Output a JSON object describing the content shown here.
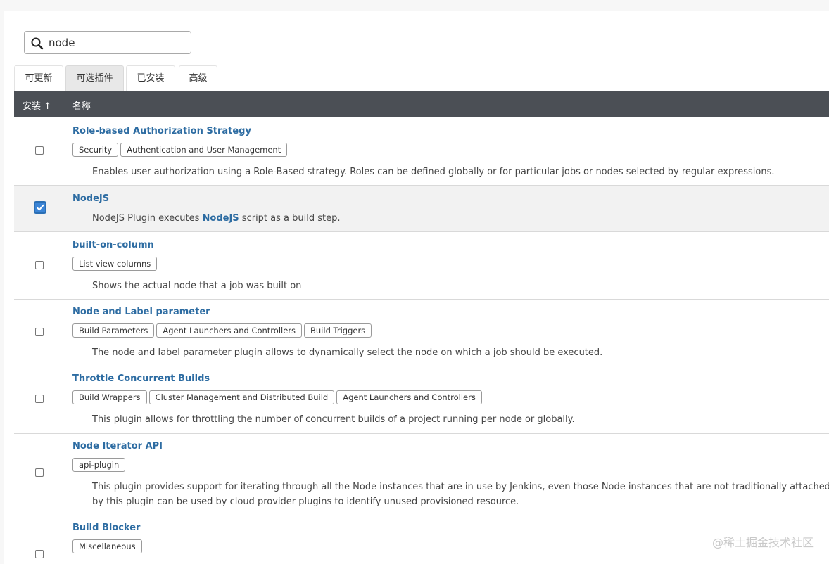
{
  "search": {
    "value": "node"
  },
  "tabs": [
    {
      "label": "可更新"
    },
    {
      "label": "可选插件"
    },
    {
      "label": "已安装"
    },
    {
      "label": "高级"
    }
  ],
  "active_tab": "可选插件",
  "table": {
    "header_install": "安装 ↑",
    "header_name": "名称"
  },
  "plugins": [
    {
      "name": "Role-based Authorization Strategy",
      "checked": false,
      "tags": [
        "Security",
        "Authentication and User Management"
      ],
      "description": "Enables user authorization using a Role-Based strategy. Roles can be defined globally or for particular jobs or nodes selected by regular expressions."
    },
    {
      "name": "NodeJS",
      "checked": true,
      "tags": [],
      "description_prefix": "NodeJS Plugin executes ",
      "description_link": "NodeJS",
      "description_suffix": " script as a build step."
    },
    {
      "name": "built-on-column",
      "checked": false,
      "tags": [
        "List view columns"
      ],
      "description": "Shows the actual node that a job was built on"
    },
    {
      "name": "Node and Label parameter",
      "checked": false,
      "tags": [
        "Build Parameters",
        "Agent Launchers and Controllers",
        "Build Triggers"
      ],
      "description": "The node and label parameter plugin allows to dynamically select the node on which a job should be executed."
    },
    {
      "name": "Throttle Concurrent Builds",
      "checked": false,
      "tags": [
        "Build Wrappers",
        "Cluster Management and Distributed Build",
        "Agent Launchers and Controllers"
      ],
      "description": "This plugin allows for throttling the number of concurrent builds of a project running per node or globally."
    },
    {
      "name": "Node Iterator API",
      "checked": false,
      "tags": [
        "api-plugin"
      ],
      "description": "This plugin provides support for iterating through all the Node instances that are in use by Jenkins, even those Node instances that are not traditionally attached to",
      "description_line2": "by this plugin can be used by cloud provider plugins to identify unused provisioned resource."
    },
    {
      "name": "Build Blocker",
      "checked": false,
      "tags": [
        "Miscellaneous"
      ]
    }
  ],
  "watermark": "@稀土掘金技术社区",
  "colors": {
    "header_bg": "#4b4f55",
    "link": "#2d6ca2",
    "checkbox_checked": "#3b84d6",
    "active_tab_bg": "#e8e8e8"
  },
  "icons": [
    "search-icon",
    "sort-up-arrow-icon",
    "checkmark-icon"
  ]
}
